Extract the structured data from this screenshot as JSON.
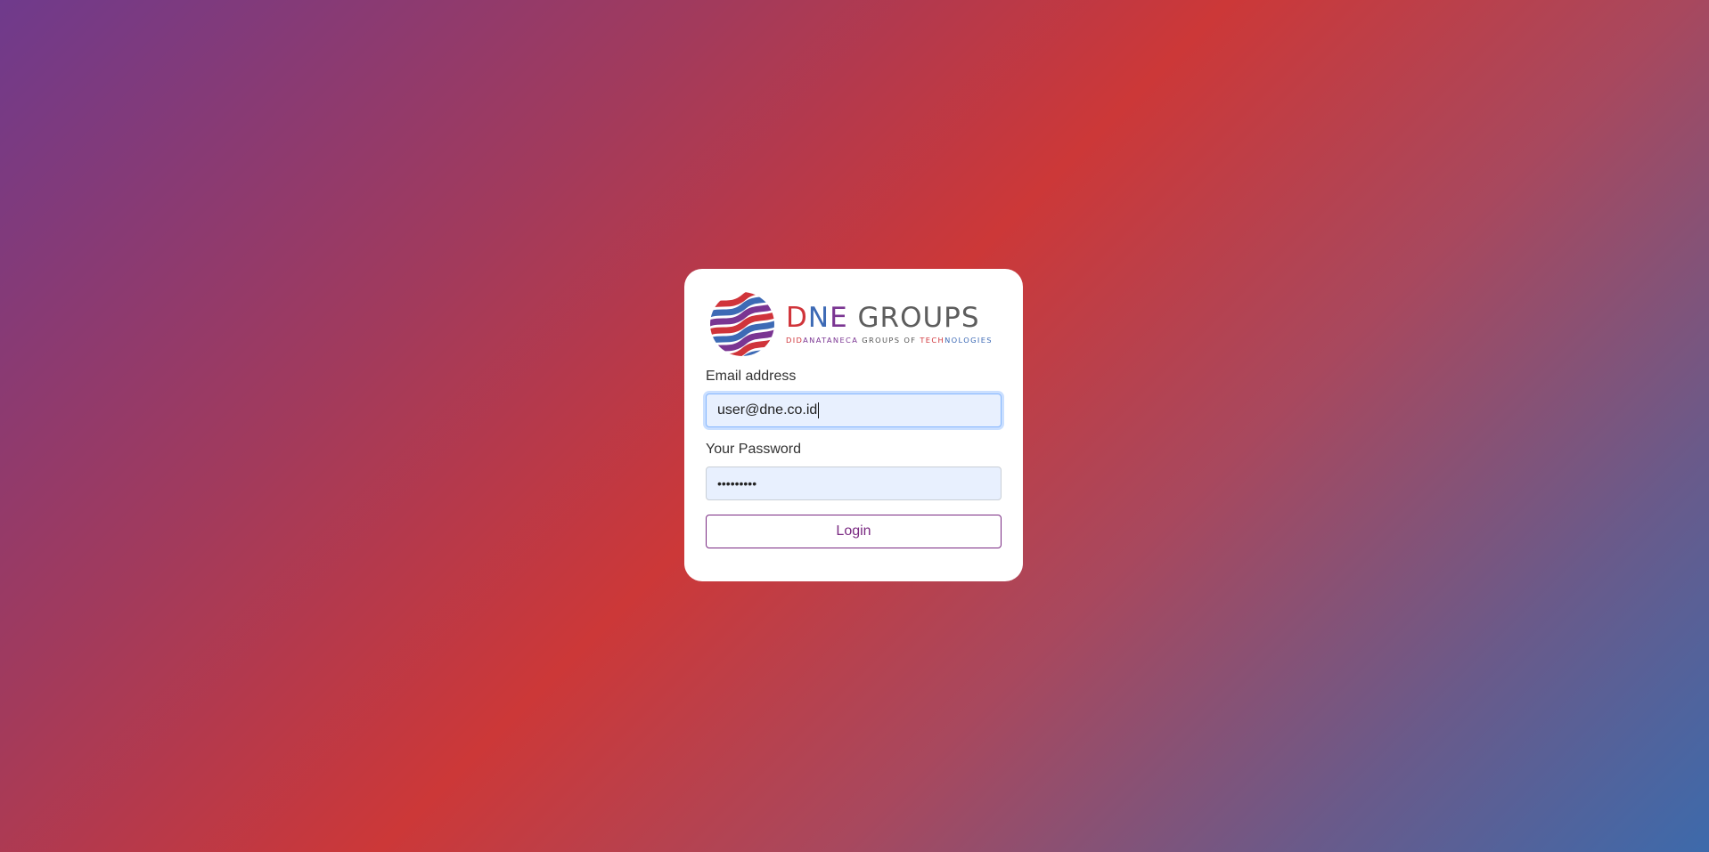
{
  "brand": {
    "name_part1": "D",
    "name_part2": "N",
    "name_part3": "E",
    "name_part4": " GROUPS",
    "tagline_part1": "DID",
    "tagline_part2": "ANATANECA",
    "tagline_part3": " GROUPS OF ",
    "tagline_part4": "TECH",
    "tagline_part5": "NOLOGIES",
    "logo_icon": "striped-globe-icon",
    "colors": {
      "red": "#d0343a",
      "blue": "#3d6ab5",
      "purple": "#7a3592",
      "gray": "#5d5d5d"
    }
  },
  "form": {
    "email_label": "Email address",
    "email_value": "user@dne.co.id",
    "password_label": "Your Password",
    "password_value": "•••••••••",
    "login_label": "Login"
  },
  "theme": {
    "button_accent": "#7a2a82",
    "input_bg": "#e8f0fe"
  }
}
